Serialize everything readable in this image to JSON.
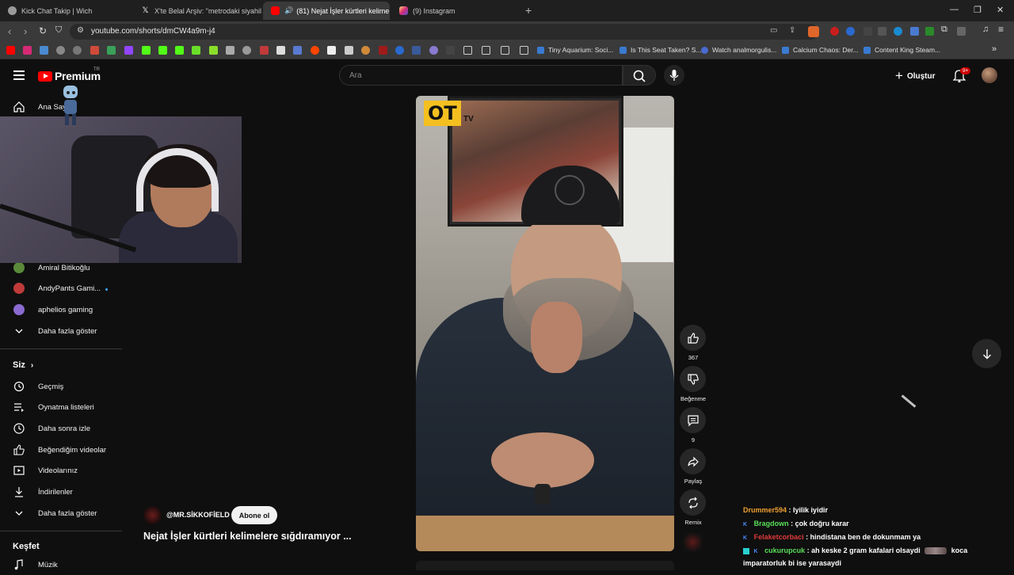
{
  "browser": {
    "tabs": [
      {
        "title": "Kick Chat Takip | Wich",
        "color": "#9a9a9a"
      },
      {
        "title": "X'te Belal Arşiv: \"metrodaki siyahileri",
        "color": "#ffffff"
      },
      {
        "title": "(81) Nejat İşler kürtleri kelime",
        "color": "#ff0000"
      },
      {
        "title": "(9) Instagram",
        "color": "#e1306c"
      }
    ],
    "new_tab": "+",
    "window_controls": [
      "—",
      "❐",
      "✕"
    ],
    "url": "youtube.com/shorts/dmCW4a9m-j4",
    "bookmarks": [
      {
        "label": "Tiny Aquarium: Soci..."
      },
      {
        "label": "Is This Seat Taken? S..."
      },
      {
        "label": "Watch analmorgulis..."
      },
      {
        "label": "Calcium Chaos: Der..."
      },
      {
        "label": "Content King Steam..."
      }
    ],
    "bookmark_more": "»"
  },
  "header": {
    "logo_text": "Premium",
    "region": "TR",
    "search_placeholder": "Ara",
    "create_label": "Oluştur",
    "notification_count": "9+"
  },
  "sidebar": {
    "top_items": [
      {
        "label": "Ana Sayfa",
        "icon": "home-icon"
      }
    ],
    "subscriptions": [
      {
        "label": "Amiral Bitikoğlu",
        "color": "#5a8a3a"
      },
      {
        "label": "AndyPants Gami...",
        "color": "#c03a3a",
        "live": true
      },
      {
        "label": "aphelios gaming",
        "color": "#8a6ad0"
      }
    ],
    "show_more_1": "Daha fazla göster",
    "you_heading": "Siz",
    "you_items": [
      {
        "label": "Geçmiş",
        "icon": "history-icon"
      },
      {
        "label": "Oynatma listeleri",
        "icon": "playlist-icon"
      },
      {
        "label": "Daha sonra izle",
        "icon": "clock-icon"
      },
      {
        "label": "Beğendiğim videolar",
        "icon": "thumbs-up-icon"
      },
      {
        "label": "Videolarınız",
        "icon": "video-icon"
      },
      {
        "label": "İndirilenler",
        "icon": "download-icon"
      }
    ],
    "show_more_2": "Daha fazla göster",
    "explore_heading": "Keşfet",
    "explore_items": [
      {
        "label": "Müzik",
        "icon": "music-icon"
      }
    ]
  },
  "video": {
    "logo_main": "OT",
    "logo_sub": "TV",
    "channel": "@MR.SİKKOFİELD",
    "subscribe_label": "Abone ol",
    "title": "Nejat İşler kürtleri kelimelere sığdıramıyor ..."
  },
  "actions": {
    "like_count": "367",
    "dislike_label": "Beğenme",
    "comment_count": "9",
    "share_label": "Paylaş",
    "remix_label": "Remix"
  },
  "chat": [
    {
      "user": "Drummer594",
      "color": "#f0a030",
      "badge": "",
      "text": ": Iyilik iyidir"
    },
    {
      "user": "Bragdown",
      "color": "#5adf5a",
      "badge": "K",
      "text": ": çok doğru karar"
    },
    {
      "user": "Felaketcorbaci",
      "color": "#e03a3a",
      "badge": "K",
      "text": ": hindistana ben de dokunmam ya"
    },
    {
      "user": "cukurupcuk",
      "color": "#5adf5a",
      "badge": "K",
      "text": ": ah keske 2 gram kafalari olsaydi",
      "suffix": "koca",
      "cont": "imparatorluk bi ise yarasaydi"
    }
  ]
}
